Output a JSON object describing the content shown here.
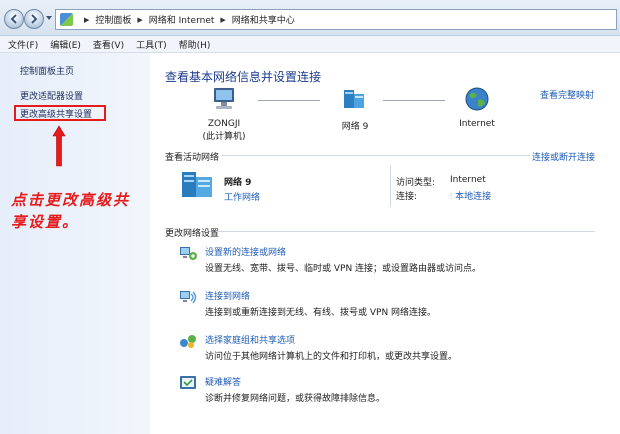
{
  "address": {
    "crumbs": [
      "控制面板",
      "网络和 Internet",
      "网络和共享中心"
    ]
  },
  "menu": [
    "文件(F)",
    "编辑(E)",
    "查看(V)",
    "工具(T)",
    "帮助(H)"
  ],
  "left_pane": {
    "home": "控制面板主页",
    "adapter": "更改适配器设置",
    "sharing": "更改高级共享设置"
  },
  "annotation": "点击更改高级共享设置。",
  "colors": {
    "annotation_red": "#e51c1c",
    "link_blue": "#1f5cb5",
    "title_blue": "#1e3c8c"
  },
  "main": {
    "title": "查看基本网络信息并设置连接",
    "full_map": "查看完整映射",
    "nodes": {
      "computer_name": "ZONGJI",
      "computer_sub": "(此计算机)",
      "network": "网络  9",
      "internet": "Internet"
    },
    "active_section": "查看活动网络",
    "connect_disconnect": "连接或断开连接",
    "active": {
      "name": "网络  9",
      "type": "工作网络",
      "access_label": "访问类型:",
      "access_value": "Internet",
      "conn_label": "连接:",
      "conn_value": "本地连接"
    },
    "change_section": "更改网络设置",
    "tasks": [
      {
        "icon": "new-connection-icon",
        "title": "设置新的连接或网络",
        "desc": "设置无线、宽带、拨号、临时或 VPN 连接；或设置路由器或访问点。"
      },
      {
        "icon": "connect-network-icon",
        "title": "连接到网络",
        "desc": "连接到或重新连接到无线、有线、拨号或 VPN 网络连接。"
      },
      {
        "icon": "homegroup-icon",
        "title": "选择家庭组和共享选项",
        "desc": "访问位于其他网络计算机上的文件和打印机，或更改共享设置。"
      },
      {
        "icon": "troubleshoot-icon",
        "title": "疑难解答",
        "desc": "诊断并修复网络问题，或获得故障排除信息。"
      }
    ]
  }
}
